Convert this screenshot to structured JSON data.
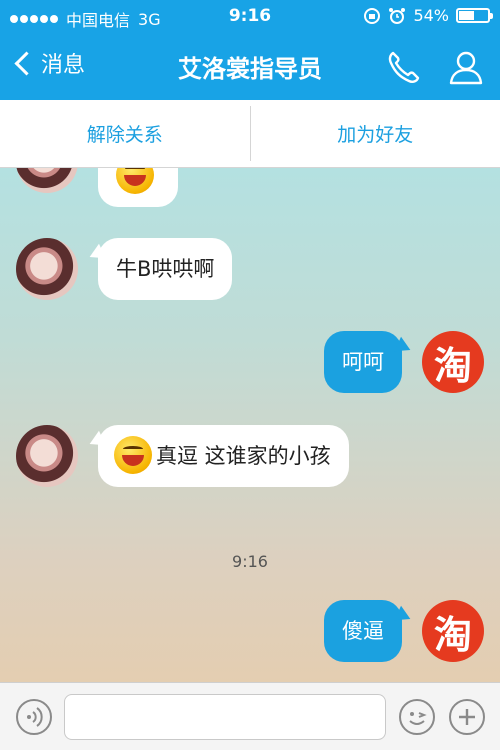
{
  "status_bar": {
    "carrier": "中国电信",
    "network": "3G",
    "time": "9:16",
    "battery": "54%",
    "battery_level": 0.54
  },
  "nav": {
    "back_label": "消息",
    "title": "艾洛裳指导员"
  },
  "actions": {
    "unfriend": "解除关系",
    "add_friend": "加为好友"
  },
  "messages": [
    {
      "side": "in",
      "text": "牛B哄哄啊"
    },
    {
      "side": "out",
      "text": "呵呵"
    },
    {
      "side": "in",
      "text": "真逗 这谁家的小孩",
      "emoji": "grin-icon"
    },
    {
      "side": "out",
      "text": "傻逼"
    }
  ],
  "timestamp": "9:16",
  "avatar_logo_char": "淘",
  "colors": {
    "accent": "#18a3e6",
    "bubble_out": "#1ba1e0",
    "logo_red": "#e53a1f"
  }
}
